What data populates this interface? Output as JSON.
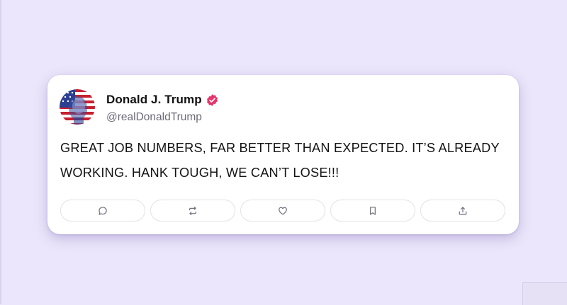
{
  "tweet": {
    "author_name": "Donald J. Trump",
    "handle": "@realDonaldTrump",
    "verified": true,
    "text": "GREAT JOB NUMBERS, FAR BETTER THAN EXPECTED. IT’S ALREADY WORKING. HANK TOUGH, WE CAN’T LOSE!!!"
  },
  "actions": [
    {
      "name": "reply",
      "icon": "reply-icon"
    },
    {
      "name": "retweet",
      "icon": "retweet-icon"
    },
    {
      "name": "like",
      "icon": "heart-icon"
    },
    {
      "name": "bookmark",
      "icon": "bookmark-icon"
    },
    {
      "name": "share",
      "icon": "share-icon"
    }
  ],
  "colors": {
    "background": "#ebe6fb",
    "card": "#ffffff",
    "verified_badge": "#e8336b",
    "icon": "#707080"
  }
}
